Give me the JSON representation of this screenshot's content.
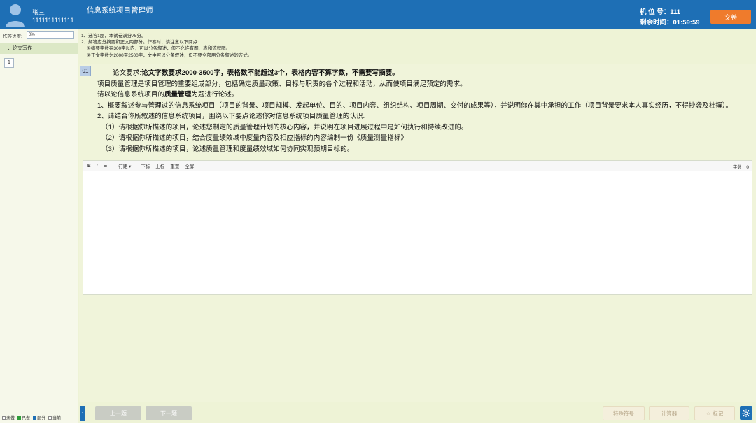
{
  "header": {
    "user_name": "张三",
    "user_id": "1111111111111",
    "exam_title": "信息系统项目管理师",
    "seat_label": "机 位 号：111",
    "remain_label": "剩余时间：01:59:59",
    "submit_label": "交卷"
  },
  "sidebar": {
    "progress_label": "作答进度:",
    "progress_value": "0%",
    "section_label": "一、论文写作",
    "question_numbers": [
      "1"
    ],
    "legend": [
      "未做",
      "已做",
      "部分",
      "当前"
    ],
    "legend_colors": [
      "#ffffff",
      "#2f9d3a",
      "#1e6fb5",
      "#ffffff"
    ]
  },
  "instructions": [
    "1、选答1题，本试卷满分75分。",
    "2、解答应分摘要和正文两部分。作答时，请注意以下两点:",
    "①摘要字数在300字以内，可以分条叙述，但不允许有图、表和流程图。",
    "②正文字数为2000至2500字，文中可以分条叙述，但不要全部用分条叙述的方式。"
  ],
  "question": {
    "number": "01",
    "req_prefix": "论文要求:",
    "req_bold": "论文字数要求2000-3500字，表格数不能超过3个，表格内容不算字数，不需要写摘要。",
    "intro": "项目质量管理是项目管理的重要组成部分，包括确定质量政策、目标与职责的各个过程和活动，从而使项目满足预定的需求。",
    "topic_pre": "请以论信息系统项目的",
    "topic_bold": "质量管理",
    "topic_post": "为题进行论述。",
    "item1": "1、概要叙述参与管理过的信息系统项目（项目的背景、项目规模、发起单位、目的、项目内容、组织结构、项目周期、交付的成果等），并说明你在其中承担的工作（项目背景要求本人真实经历，不得抄袭及杜撰）。",
    "item2": "2、请结合你所叙述的信息系统项目，围绕以下要点论述你对信息系统项目质量管理的认识:",
    "sub1": "（1）请根据你所描述的项目，论述您制定的质量管理计划的核心内容，并说明在项目进展过程中是如何执行和持续改进的。",
    "sub2": "（2）请根据你所描述的项目，结合度量绩效域中度量内容及相应指标的内容编制一份《质量测量指标》",
    "sub3": "（3）请根据你所描述的项目，论述质量管理和度量绩效域如何协同实现预期目标的。"
  },
  "editor": {
    "toolbar": [
      "B",
      "I",
      "☰",
      "行距 ▾",
      "下标",
      "上标",
      "重置",
      "全屏"
    ],
    "word_count": "字数：0"
  },
  "footer": {
    "prev": "上一题",
    "next": "下一题",
    "special": "特殊符号",
    "calculator": "计算器",
    "mark": "标记"
  }
}
